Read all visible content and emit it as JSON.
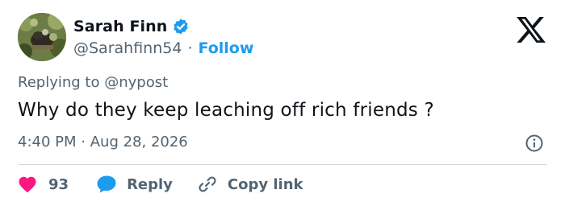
{
  "author": {
    "name": "Sarah Finn",
    "handle": "@Sarahfinn54",
    "follow_label": "Follow",
    "separator": "·",
    "verified": true
  },
  "reply_context": {
    "prefix": "Replying to",
    "mention": "@nypost"
  },
  "tweet": {
    "text": "Why do they keep leaching off rich friends ?",
    "time": "4:40 PM",
    "separator": "·",
    "date": "Aug 28, 2026"
  },
  "actions": {
    "likes_count": "93",
    "reply_label": "Reply",
    "copy_link_label": "Copy link"
  },
  "colors": {
    "accent": "#1d9bf0",
    "like": "#f91880",
    "text": "#0f1419",
    "muted": "#536471",
    "divider": "#cfd9de"
  },
  "icons": {
    "brand": "x-logo-icon",
    "verified": "verified-badge-icon",
    "info": "info-icon",
    "like": "heart-icon",
    "reply": "speech-bubble-icon",
    "copy": "link-icon"
  }
}
